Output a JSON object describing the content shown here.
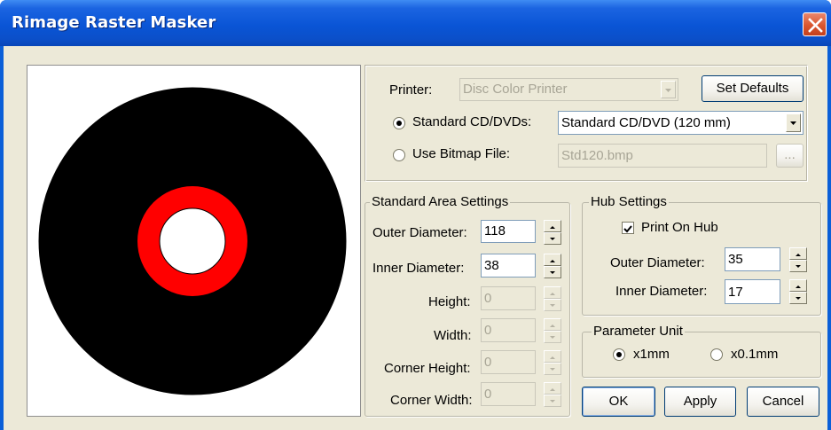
{
  "window": {
    "title": "Rimage Raster Masker"
  },
  "printer": {
    "label": "Printer:",
    "value": "Disc Color Printer",
    "set_defaults_label": "Set Defaults"
  },
  "source": {
    "standard_label": "Standard CD/DVDs:",
    "standard_selected": true,
    "standard_value": "Standard CD/DVD (120 mm)",
    "bitmap_label": "Use Bitmap File:",
    "bitmap_selected": false,
    "bitmap_value": "Std120.bmp",
    "browse_label": "..."
  },
  "standard_area": {
    "title": "Standard Area Settings",
    "outer_diameter": {
      "label": "Outer Diameter:",
      "value": "118"
    },
    "inner_diameter": {
      "label": "Inner Diameter:",
      "value": "38"
    },
    "height": {
      "label": "Height:",
      "value": "0"
    },
    "width": {
      "label": "Width:",
      "value": "0"
    },
    "corner_height": {
      "label": "Corner Height:",
      "value": "0"
    },
    "corner_width": {
      "label": "Corner Width:",
      "value": "0"
    }
  },
  "hub": {
    "title": "Hub Settings",
    "print_on_hub_label": "Print On Hub",
    "print_on_hub_checked": true,
    "outer_diameter": {
      "label": "Outer Diameter:",
      "value": "35"
    },
    "inner_diameter": {
      "label": "Inner Diameter:",
      "value": "17"
    }
  },
  "unit": {
    "title": "Parameter Unit",
    "x1mm_label": "x1mm",
    "x01mm_label": "x0.1mm",
    "selected": "x1mm"
  },
  "buttons": {
    "ok": "OK",
    "apply": "Apply",
    "cancel": "Cancel"
  },
  "colors": {
    "disc": "#000000",
    "hub_ring": "#ff0000",
    "hole": "#ffffff"
  }
}
